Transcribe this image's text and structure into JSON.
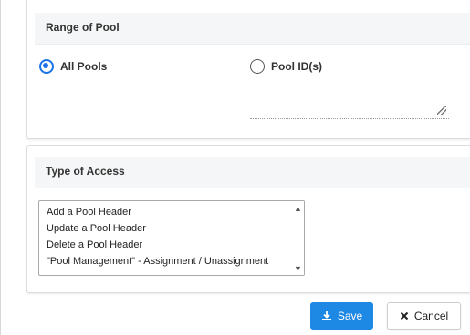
{
  "range_section": {
    "title": "Range of Pool",
    "options": [
      {
        "label": "All Pools",
        "checked": true
      },
      {
        "label": "Pool ID(s)",
        "checked": false
      }
    ],
    "pool_ids_value": ""
  },
  "access_section": {
    "title": "Type of Access",
    "items": [
      "Add a Pool Header",
      "Update a Pool Header",
      "Delete a Pool Header",
      "\"Pool Management\" - Assignment / Unassignment"
    ]
  },
  "actions": {
    "save_label": "Save",
    "cancel_label": "Cancel"
  },
  "colors": {
    "accent": "#1a73e8",
    "save_bg": "#1e88e5",
    "header_bg": "#f5f6f7"
  },
  "icons": {
    "save": "download-icon",
    "cancel": "close-icon"
  }
}
